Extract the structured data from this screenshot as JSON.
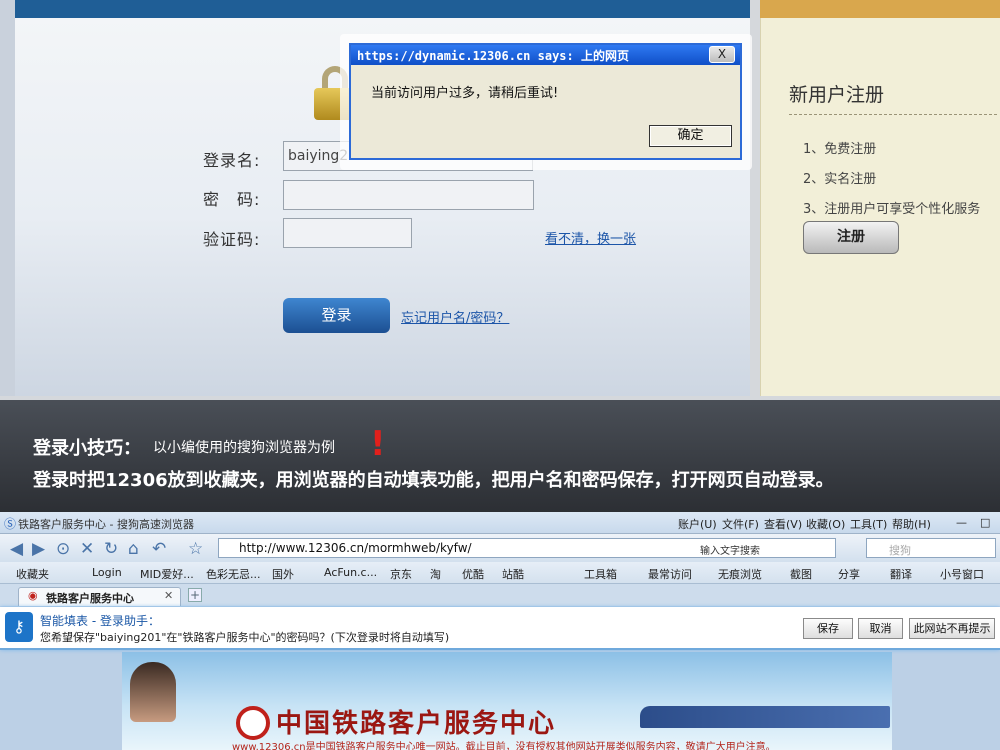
{
  "login": {
    "username_label": "登录名:",
    "username_value": "baiying201",
    "password_label": "密　码:",
    "captcha_label": "验证码:",
    "captcha_refresh": "看不清，换一张",
    "login_button": "登录",
    "forgot_link": "忘记用户名/密码？"
  },
  "register": {
    "title": "新用户注册",
    "items": [
      "1、免费注册",
      "2、实名注册",
      "3、注册用户可享受个性化服务"
    ],
    "button": "注册"
  },
  "alert": {
    "title": "https://dynamic.12306.cn says: 上的网页",
    "close": "X",
    "message": "当前访问用户过多，请稍后重试!",
    "ok": "确定"
  },
  "tips": {
    "title": "登录小技巧：",
    "subtitle": "以小编使用的搜狗浏览器为例",
    "mark": "!",
    "text": "登录时把12306放到收藏夹，用浏览器的自动填表功能，把用户名和密码保存，打开网页自动登录。"
  },
  "browser": {
    "window_title": "铁路客户服务中心 - 搜狗高速浏览器",
    "menu": [
      "账户(U)",
      "文件(F)",
      "查看(V)",
      "收藏(O)",
      "工具(T)",
      "帮助(H)"
    ],
    "window_controls": [
      "—",
      "□"
    ],
    "address": "http://www.12306.cn/mormhweb/kyfw/",
    "address_hint": "输入文字搜索",
    "search_placeholder": "搜狗",
    "favorites": [
      "收藏夹",
      "Login",
      "MID爱好...",
      "色彩无忌...",
      "国外",
      "AcFun.c...",
      "京东",
      "淘",
      "优酷",
      "站酷",
      "工具箱",
      "最常访问",
      "无痕浏览",
      "截图",
      "分享",
      "翻译",
      "小号窗口"
    ],
    "tab_label": "铁路客户服务中心",
    "tab_close": "✕",
    "tab_add": "+",
    "autofill_title": "智能填表 - 登录助手：",
    "autofill_message": "您希望保存\"baiying201\"在\"铁路客户服务中心\"的密码吗？(下次登录时将自动填写)",
    "autofill_buttons": [
      "保存",
      "取消",
      "此网站不再提示"
    ],
    "site_name": "中国铁路客户服务中心",
    "site_notice": "www.12306.cn是中国铁路客户服务中心唯一网站。截止目前，没有授权其他网站开展类似服务内容，敬请广大用户注意。"
  }
}
